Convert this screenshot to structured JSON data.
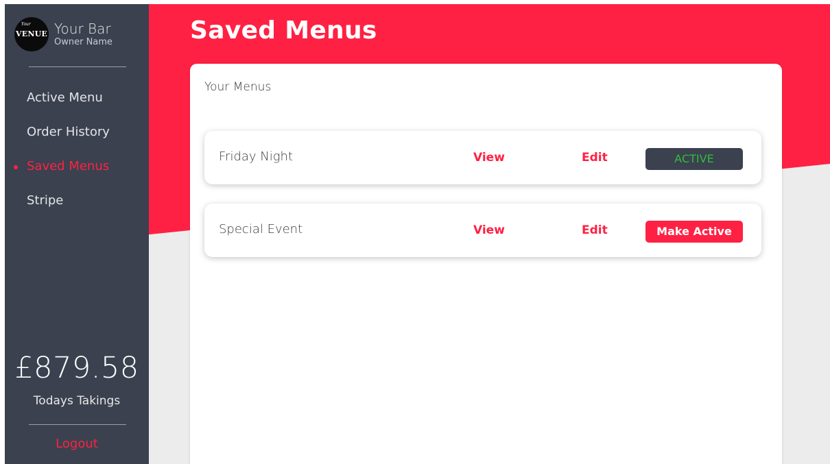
{
  "colors": {
    "accent": "#ff2143",
    "sidebar": "#3b414f",
    "background": "#ececec",
    "active_text": "#2fbe3c"
  },
  "brand": {
    "logo_small_text": "Your",
    "logo_text": "VENUE",
    "bar_name": "Your Bar",
    "owner_name": "Owner Name"
  },
  "nav": {
    "items": [
      {
        "label": "Active Menu",
        "active": false
      },
      {
        "label": "Order History",
        "active": false
      },
      {
        "label": "Saved Menus",
        "active": true
      },
      {
        "label": "Stripe",
        "active": false
      }
    ]
  },
  "takings": {
    "amount": "£879.58",
    "label": "Todays Takings"
  },
  "logout_label": "Logout",
  "page": {
    "title": "Saved Menus",
    "section_title": "Your Menus"
  },
  "menus": [
    {
      "name": "Friday Night",
      "view_label": "View",
      "edit_label": "Edit",
      "status_label": "ACTIVE"
    },
    {
      "name": "Special Event",
      "view_label": "View",
      "edit_label": "Edit",
      "status_label": "Make Active"
    }
  ]
}
